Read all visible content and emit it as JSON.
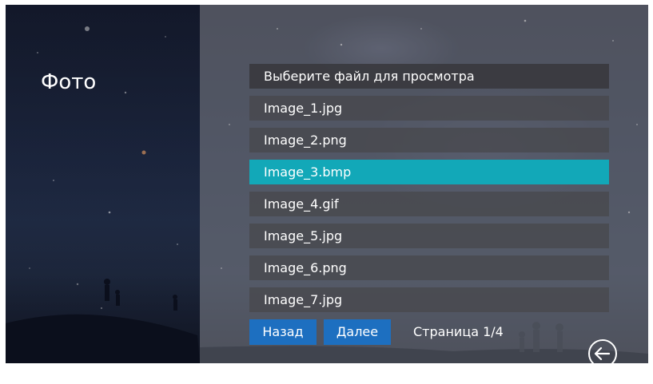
{
  "screen": {
    "title": "Фото"
  },
  "file_list": {
    "header": "Выберите файл для просмотра",
    "items": [
      {
        "name": "Image_1.jpg",
        "selected": false
      },
      {
        "name": "Image_2.png",
        "selected": false
      },
      {
        "name": "Image_3.bmp",
        "selected": true
      },
      {
        "name": "Image_4.gif",
        "selected": false
      },
      {
        "name": "Image_5.jpg",
        "selected": false
      },
      {
        "name": "Image_6.png",
        "selected": false
      },
      {
        "name": "Image_7.jpg",
        "selected": false
      }
    ]
  },
  "pagination": {
    "back_label": "Назад",
    "next_label": "Далее",
    "page_label": "Страница 1/4"
  },
  "icons": {
    "back": "back-arrow-circle-icon"
  },
  "colors": {
    "selected_row": "#12a8b8",
    "button": "#1d6fc0",
    "row": "#46464b",
    "text": "#ffffff"
  }
}
